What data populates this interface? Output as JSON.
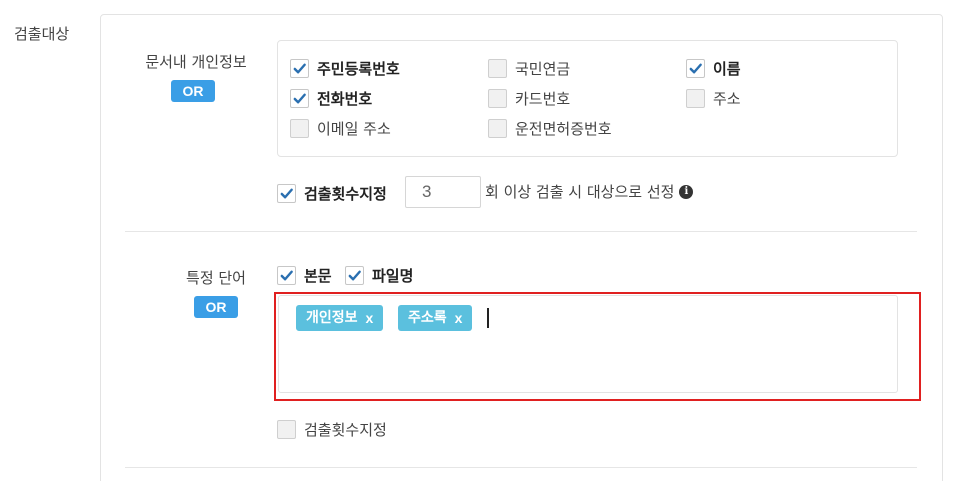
{
  "section": {
    "label": "검출대상"
  },
  "personal_info": {
    "label": "문서내 개인정보",
    "or_badge": "OR",
    "options": [
      {
        "label": "주민등록번호",
        "checked": true
      },
      {
        "label": "국민연금",
        "checked": false
      },
      {
        "label": "이름",
        "checked": true
      },
      {
        "label": "전화번호",
        "checked": true
      },
      {
        "label": "카드번호",
        "checked": false
      },
      {
        "label": "주소",
        "checked": false
      },
      {
        "label": "이메일 주소",
        "checked": false
      },
      {
        "label": "운전면허증번호",
        "checked": false
      }
    ],
    "count_toggle": {
      "label": "검출횟수지정",
      "checked": true
    },
    "count_value": "3",
    "count_suffix": "회 이상 검출 시 대상으로 선정"
  },
  "keywords": {
    "label": "특정 단어",
    "or_badge": "OR",
    "scope": [
      {
        "label": "본문",
        "checked": true
      },
      {
        "label": "파일명",
        "checked": true
      }
    ],
    "tags": [
      {
        "text": "개인정보",
        "remove": "x"
      },
      {
        "text": "주소록",
        "remove": "x"
      }
    ],
    "count_toggle": {
      "label": "검출횟수지정",
      "checked": false
    }
  },
  "icons": {
    "check": "check-icon",
    "info": "info-icon",
    "remove": "remove-tag-icon"
  },
  "colors": {
    "badge": "#3a9ee6",
    "tag": "#5bc0de",
    "highlight": "#e02020",
    "check": "#2a6fb0"
  }
}
